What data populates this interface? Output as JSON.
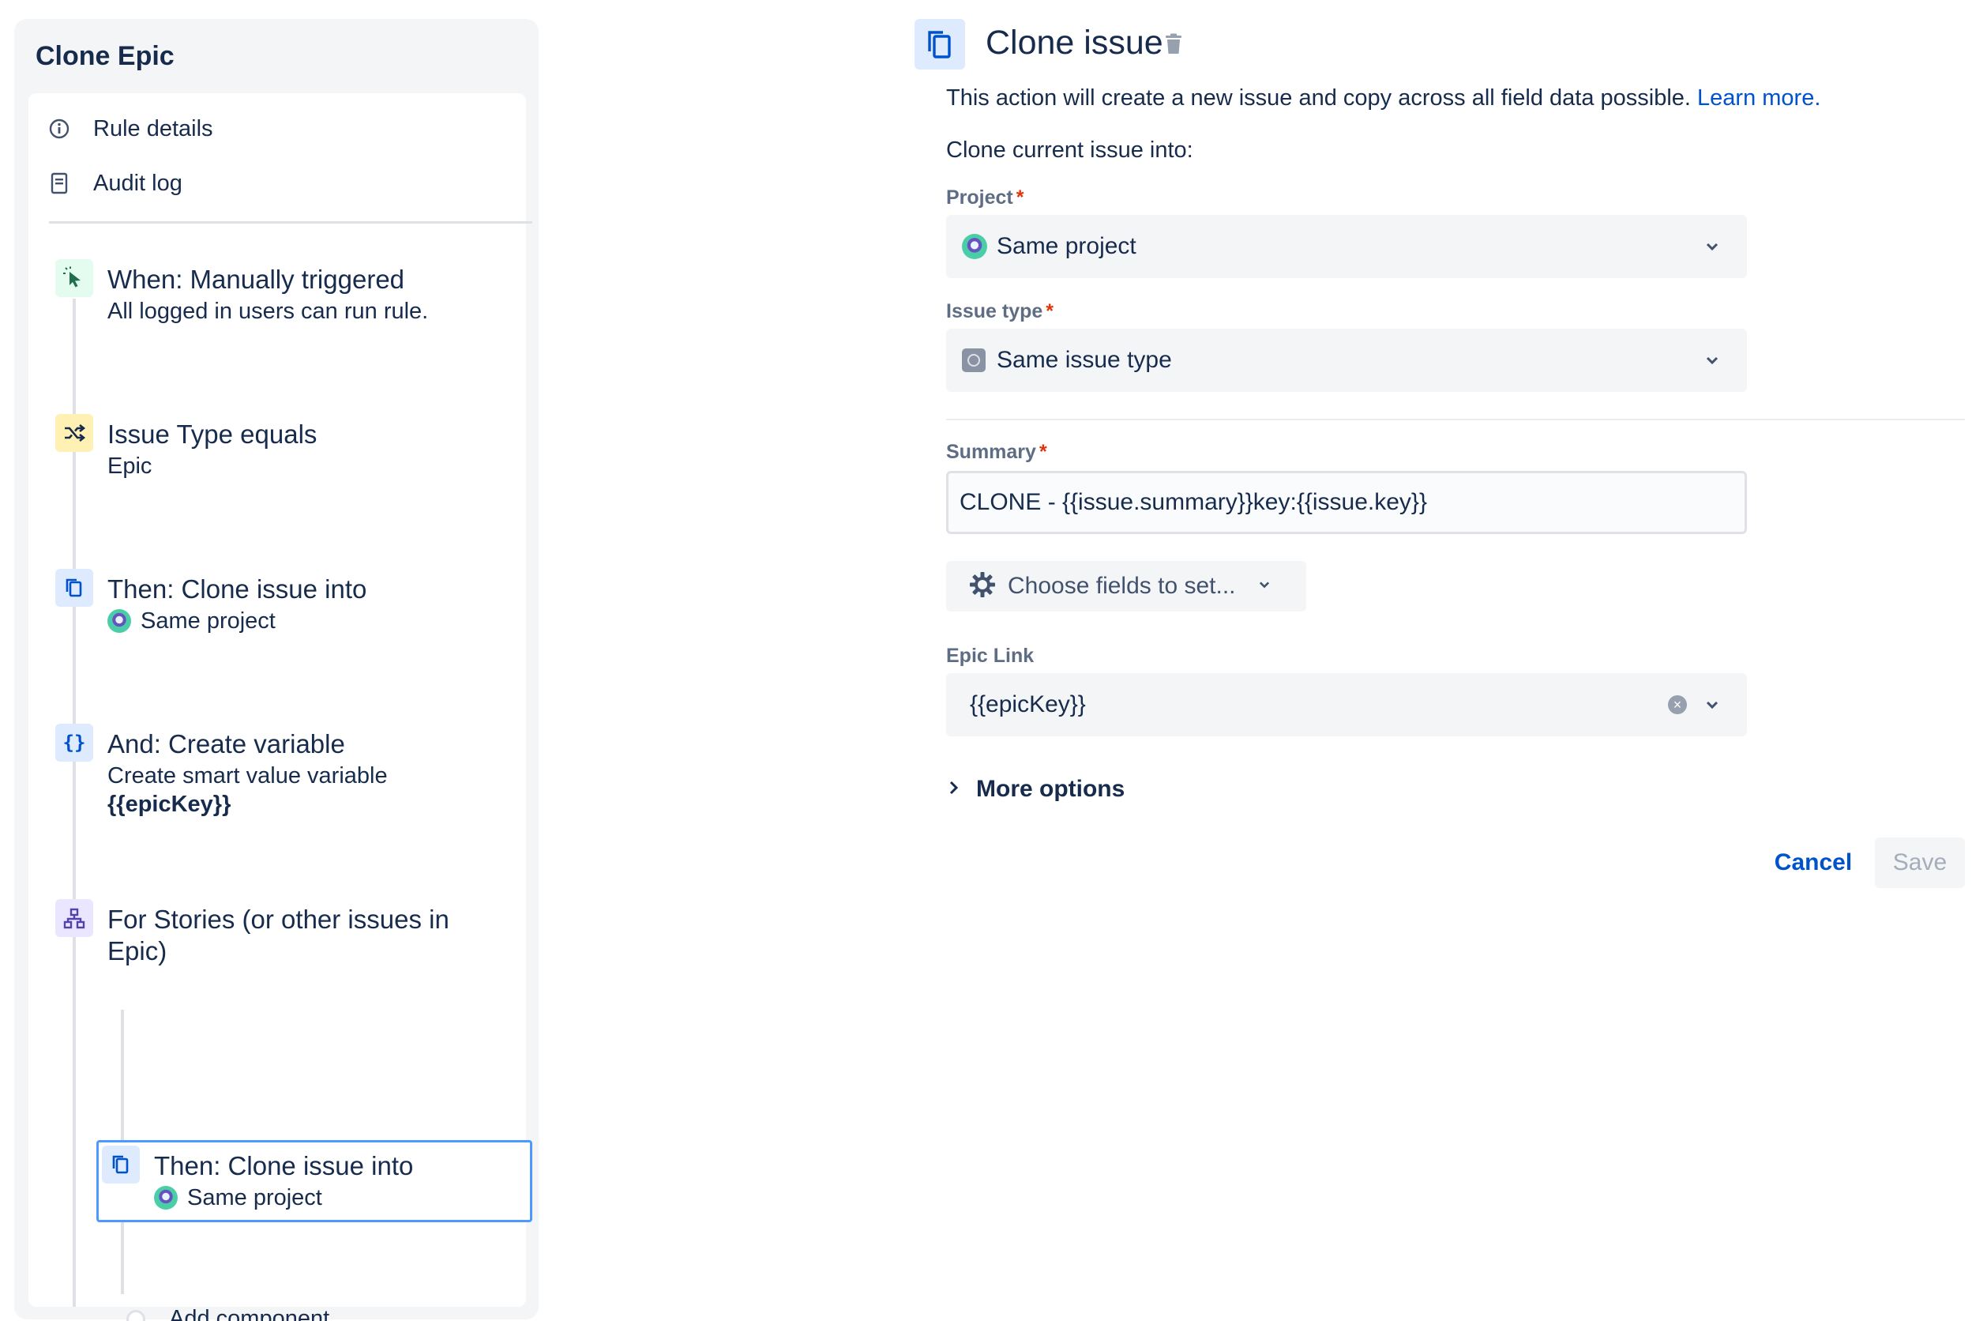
{
  "rule": {
    "title": "Clone Epic",
    "menu": [
      {
        "label": "Rule details",
        "icon": "info-icon"
      },
      {
        "label": "Audit log",
        "icon": "document-icon"
      }
    ],
    "steps": [
      {
        "title": "When: Manually triggered",
        "sub": "All logged in users can run rule.",
        "icon": "cursor-click-icon",
        "color": "#e3fcef"
      },
      {
        "title": "Issue Type equals",
        "sub": "Epic",
        "icon": "shuffle-icon",
        "color": "#fff0b3"
      },
      {
        "title": "Then: Clone issue into",
        "sub": "Same project",
        "icon": "copy-icon",
        "color": "#deebff"
      },
      {
        "title": "And: Create variable",
        "sub": "Create smart value variable",
        "sub2": "{{epicKey}}",
        "icon": "braces-icon",
        "color": "#deebff"
      },
      {
        "title": "For Stories (or other issues in",
        "title2": "Epic)",
        "icon": "hierarchy-icon",
        "color": "#eae6ff"
      },
      {
        "title": "Then: Clone issue into",
        "sub": "Same project",
        "icon": "copy-icon",
        "color": "#deebff"
      }
    ],
    "add_component": "Add component"
  },
  "config": {
    "title": "Clone issue",
    "description": "This action will create a new issue and copy across all field data possible.",
    "learn_more": "Learn more.",
    "clone_into": "Clone current issue into:",
    "project": {
      "label": "Project",
      "required": "*",
      "value": "Same project"
    },
    "issue_type": {
      "label": "Issue type",
      "required": "*",
      "value": "Same issue type"
    },
    "summary": {
      "label": "Summary",
      "required": "*",
      "value": "CLONE - {{issue.summary}}key:{{issue.key}}"
    },
    "choose_fields": "Choose fields to set...",
    "epic_link": {
      "label": "Epic Link",
      "value": "{{epicKey}}"
    },
    "more_options": "More options",
    "cancel": "Cancel",
    "save": "Save"
  },
  "colors": {
    "accent": "#0052cc",
    "selected_border": "#4c9aff",
    "required": "#de350b"
  }
}
